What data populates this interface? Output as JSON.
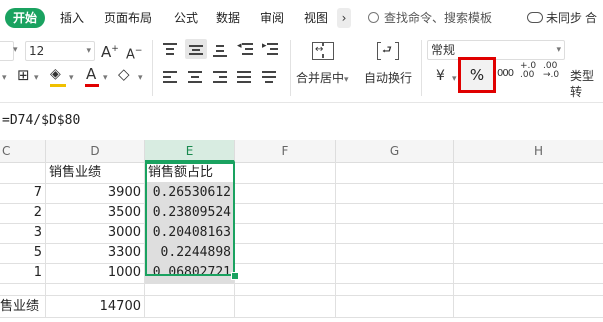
{
  "menu": {
    "tabs": [
      "开始",
      "插入",
      "页面布局",
      "公式",
      "数据",
      "审阅",
      "视图"
    ],
    "active_tab": "开始",
    "more_chevron": "›",
    "search_placeholder": "查找命令、搜索模板",
    "sync_status": "未同步",
    "share_label": "合"
  },
  "toolbar": {
    "font_name": "",
    "font_size": "12",
    "number_format": "常规",
    "merge_center_label": "合并居中",
    "wrap_text_label": "自动换行",
    "currency_symbol": "¥",
    "percent_symbol": "%",
    "comma_symbol": "000",
    "increase_decimal": "+.0 .00",
    "decrease_decimal": ".00 →.0",
    "type_convert_label": "类型转",
    "accent_color": "#1aa260",
    "highlight_color": "#e00000"
  },
  "formula_bar": {
    "formula": "=D74/$D$80"
  },
  "sheet": {
    "columns": [
      "C",
      "D",
      "E",
      "F",
      "G",
      "H"
    ],
    "selected_column": "E",
    "header_row": {
      "D": "销售业绩",
      "E": "销售额占比"
    },
    "rows": [
      {
        "C": "7",
        "D": "3900",
        "E": "0.26530612"
      },
      {
        "C": "2",
        "D": "3500",
        "E": "0.23809524"
      },
      {
        "C": "3",
        "D": "3000",
        "E": "0.20408163"
      },
      {
        "C": "5",
        "D": "3300",
        "E": "0.2244898"
      },
      {
        "C": "1",
        "D": "1000",
        "E": "0.06802721"
      }
    ],
    "total_row": {
      "C": "售业绩",
      "D": "14700"
    }
  }
}
